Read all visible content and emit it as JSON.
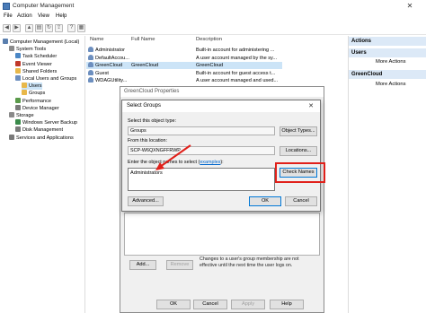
{
  "window": {
    "title": "Computer Management",
    "close_glyph": "✕"
  },
  "menu": [
    "File",
    "Action",
    "View",
    "Help"
  ],
  "toolbar_icons": [
    "back-icon",
    "forward-icon",
    "up-folder-icon",
    "show-tree-icon",
    "refresh-icon",
    "export-icon",
    "help-icon",
    "properties-icon"
  ],
  "tree": [
    {
      "label": "Computer Management (Local)",
      "indent": 0,
      "icon": "computer-icon",
      "color": "#5a7fae"
    },
    {
      "label": "System Tools",
      "indent": 1,
      "icon": "tools-icon",
      "color": "#8a8a8a"
    },
    {
      "label": "Task Scheduler",
      "indent": 2,
      "icon": "clock-icon",
      "color": "#4a86c5"
    },
    {
      "label": "Event Viewer",
      "indent": 2,
      "icon": "event-icon",
      "color": "#c0392b"
    },
    {
      "label": "Shared Folders",
      "indent": 2,
      "icon": "folder-icon",
      "color": "#e8b84a"
    },
    {
      "label": "Local Users and Groups",
      "indent": 2,
      "icon": "users-icon",
      "color": "#6d8fbf"
    },
    {
      "label": "Users",
      "indent": 3,
      "icon": "folder-icon",
      "color": "#e8b84a",
      "selected": true
    },
    {
      "label": "Groups",
      "indent": 3,
      "icon": "folder-icon",
      "color": "#e8b84a"
    },
    {
      "label": "Performance",
      "indent": 2,
      "icon": "performance-icon",
      "color": "#5a9a4a"
    },
    {
      "label": "Device Manager",
      "indent": 2,
      "icon": "device-icon",
      "color": "#7a7a7a"
    },
    {
      "label": "Storage",
      "indent": 1,
      "icon": "storage-icon",
      "color": "#8a8a8a"
    },
    {
      "label": "Windows Server Backup",
      "indent": 2,
      "icon": "backup-icon",
      "color": "#3a8a4a"
    },
    {
      "label": "Disk Management",
      "indent": 2,
      "icon": "disk-icon",
      "color": "#7a7a7a"
    },
    {
      "label": "Services and Applications",
      "indent": 1,
      "icon": "services-icon",
      "color": "#7a7a7a"
    }
  ],
  "list": {
    "headers": [
      "Name",
      "Full Name",
      "Description"
    ],
    "rows": [
      {
        "name": "Administrator",
        "full": "",
        "desc": "Built-in account for administering ..."
      },
      {
        "name": "DefaultAccou...",
        "full": "",
        "desc": "A user account managed by the sy..."
      },
      {
        "name": "GreenCloud",
        "full": "GreenCloud",
        "desc": "GreenCloud",
        "selected": true
      },
      {
        "name": "Guest",
        "full": "",
        "desc": "Built-in account for guest access t..."
      },
      {
        "name": "WDAGUtility...",
        "full": "",
        "desc": "A user account managed and used..."
      }
    ]
  },
  "actions": {
    "sections": [
      {
        "title": "Actions",
        "items": []
      },
      {
        "title": "Users",
        "items": [
          "More Actions"
        ]
      },
      {
        "title": "GreenCloud",
        "items": [
          "More Actions"
        ]
      }
    ]
  },
  "props": {
    "title": "GreenCloud Properties",
    "add_label": "Add...",
    "remove_label": "Remove",
    "note": "Changes to a user's group membership are not effective until the next time the user logs on.",
    "ok_label": "OK",
    "cancel_label": "Cancel",
    "apply_label": "Apply",
    "help_label": "Help"
  },
  "select_groups": {
    "title": "Select Groups",
    "close_glyph": "✕",
    "object_type_label": "Select this object type:",
    "object_type_value": "Groups",
    "object_types_button": "Object Types...",
    "location_label": "From this location:",
    "location_value": "SCP-W6QXNGFFRWP",
    "locations_button": "Locations...",
    "names_label_prefix": "Enter the object names to select (",
    "names_link": "examples",
    "names_label_suffix": "):",
    "names_value": "Administrators",
    "check_names_button": "Check Names",
    "advanced_button": "Advanced...",
    "ok_button": "OK",
    "cancel_button": "Cancel"
  },
  "colors": {
    "highlight": "#e0201a",
    "selection": "#cce4f7",
    "actions_header": "#dce9f7"
  }
}
